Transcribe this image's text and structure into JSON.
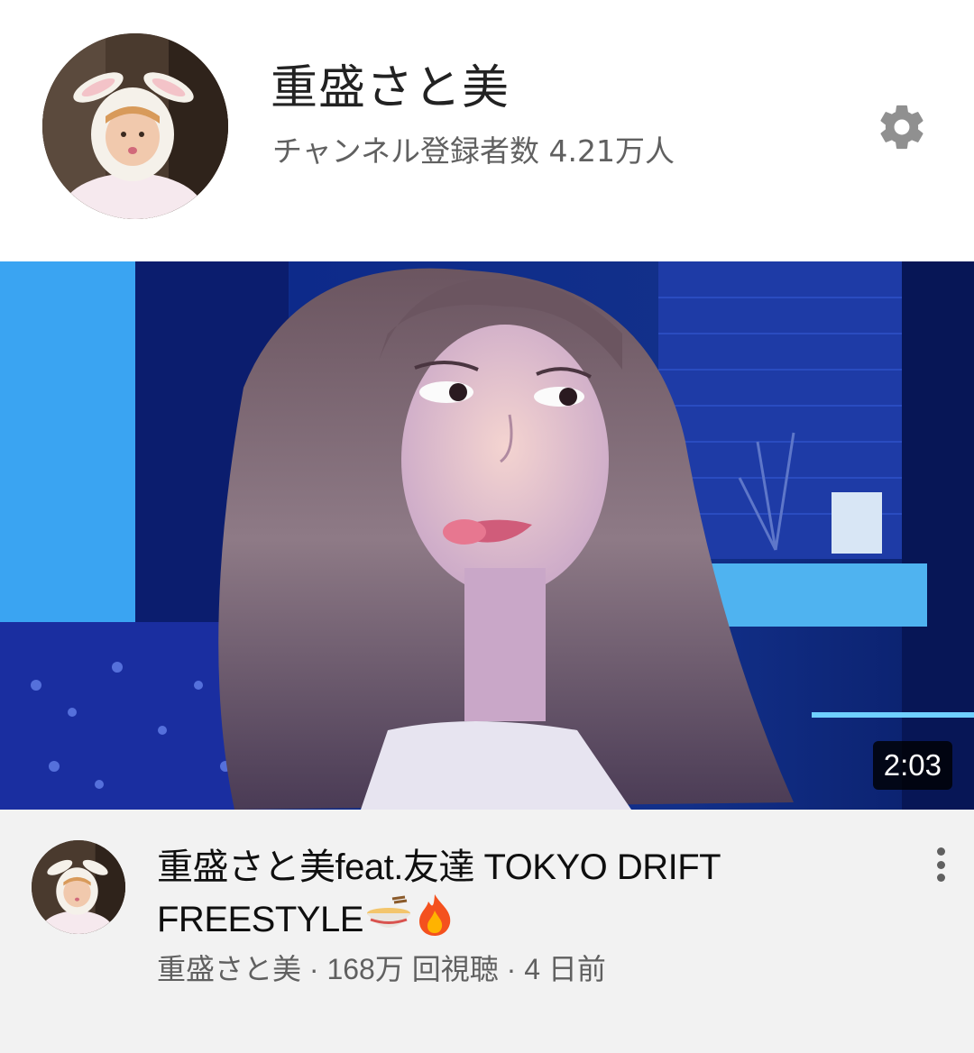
{
  "channel": {
    "name": "重盛さと美",
    "subscribers": "チャンネル登録者数 4.21万人",
    "avatar_icon": "channel-avatar",
    "settings_icon": "gear-icon"
  },
  "video": {
    "duration": "2:03",
    "title_text": "重盛さと美feat.友達 TOKYO DRIFT FREESTYLE",
    "title_emojis": [
      "ramen-bowl-emoji",
      "fire-emoji"
    ],
    "channel_name": "重盛さと美",
    "views": "168万 回視聴",
    "age": "4 日前",
    "separator": "·",
    "more_icon": "more-vert-icon"
  },
  "colors": {
    "background": "#ffffff",
    "info_background": "#f2f2f2",
    "primary_text": "#0f0f0f",
    "secondary_text": "#606060",
    "settings_icon": "#909090"
  }
}
